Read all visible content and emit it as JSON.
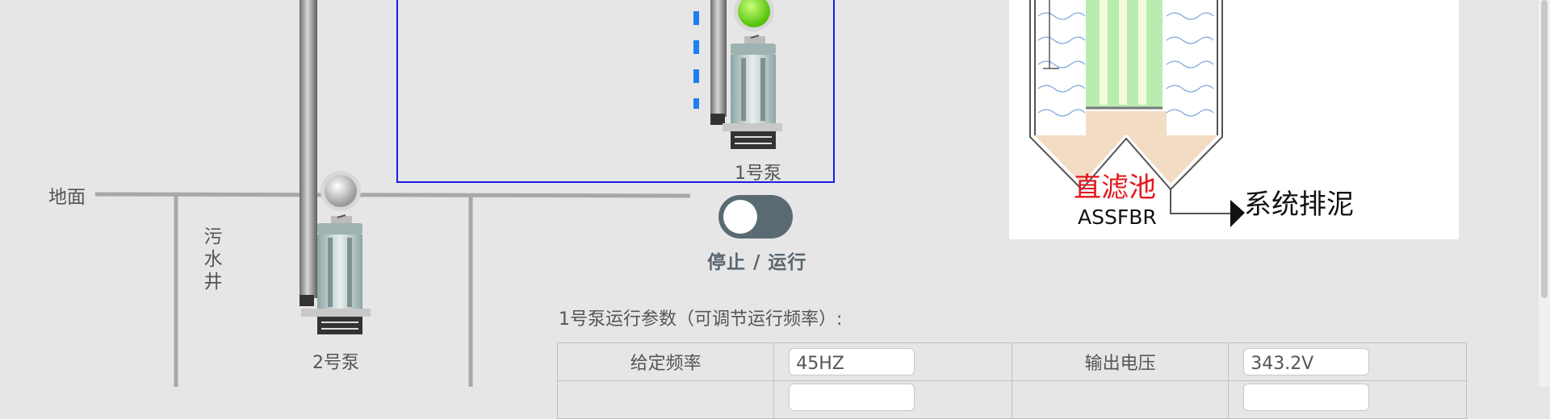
{
  "scene": {
    "ground_label": "地面",
    "well_label": "污水井",
    "pump2_label": "2号泵",
    "pump1_label": "1号泵"
  },
  "toggle": {
    "caption": "停止 / 运行",
    "state": "stopped"
  },
  "indicators": {
    "pump1_lamp": "green",
    "pump2_lamp": "gray"
  },
  "filter": {
    "name": "直滤池",
    "code": "ASSFBR",
    "sludge_label": "系统排泥"
  },
  "params": {
    "title": "1号泵运行参数（可调节运行频率）:",
    "row1": {
      "label_a": "给定频率",
      "value_a": "45HZ",
      "label_b": "输出电压",
      "value_b": "343.2V"
    }
  },
  "colors": {
    "background": "#e6e6e6",
    "frame_blue": "#1a1ae6",
    "flow_blue": "#1e7ff0",
    "lamp_green": "#7ee01e",
    "toggle_track": "#5a6a72",
    "filter_red": "#e4161c"
  }
}
